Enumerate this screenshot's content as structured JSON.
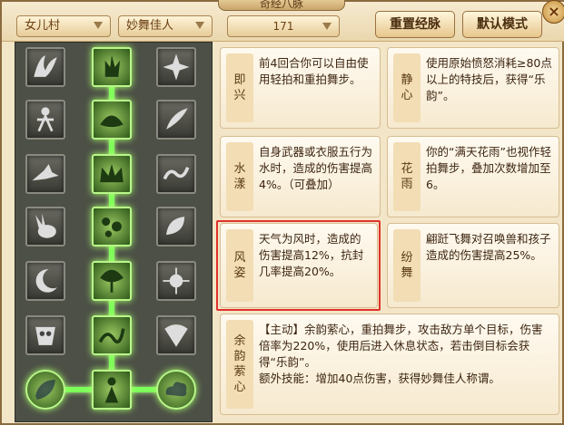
{
  "window": {
    "title": "奇经八脉",
    "close": "×"
  },
  "filters": {
    "school": "女儿村",
    "class": "妙舞佳人",
    "level": "171"
  },
  "buttons": {
    "reset": "重置经脉",
    "default": "默认模式"
  },
  "tree": {
    "left_column": [
      "wing-icon",
      "dancer-icon",
      "crow-icon",
      "rabbit-icon",
      "moon-icon",
      "mask-icon",
      "leaf-icon"
    ],
    "center_column": [
      "hands-icon",
      "lotus-icon",
      "crown-icon",
      "bubbles-icon",
      "tree-icon",
      "serpent-icon",
      "figure-icon"
    ],
    "right_column": [
      "star-icon",
      "feather-icon",
      "wave-icon",
      "leaf-icon",
      "spark-icon",
      "fan-icon",
      "cloud-icon"
    ],
    "active": {
      "center": [
        0,
        1,
        2,
        3,
        4,
        5,
        6
      ],
      "left": [
        6
      ],
      "right": [
        6
      ]
    }
  },
  "cards": [
    {
      "label": "即兴",
      "text": "前4回合你可以自由使用轻拍和重拍舞步。"
    },
    {
      "label": "静心",
      "text": "使用原始愤怒消耗≥80点以上的特技后，获得“乐韵”。"
    },
    {
      "label": "水漾",
      "text": "自身武器或衣服五行为水时，造成的伤害提高4%。（可叠加）"
    },
    {
      "label": "花雨",
      "text": "你的“满天花雨”也视作轻拍舞步，叠加次数增加至6。"
    },
    {
      "label": "风姿",
      "text": "天气为风时，造成的伤害提高12%，抗封几率提高20%。"
    },
    {
      "label": "纷舞",
      "text": "翩跹飞舞对召唤兽和孩子造成的伤害提高25%。"
    },
    {
      "label": "余韵萦心",
      "text": "【主动】余韵萦心，重拍舞步，攻击敌方单个目标，伤害倍率为220%，使用后进入休息状态，若击倒目标会获得“乐韵”。\n额外技能：增加40点伤害，获得妙舞佳人称谓。"
    }
  ],
  "colors": {
    "active_glow": "#7dff5a",
    "highlight": "#e0322a"
  }
}
